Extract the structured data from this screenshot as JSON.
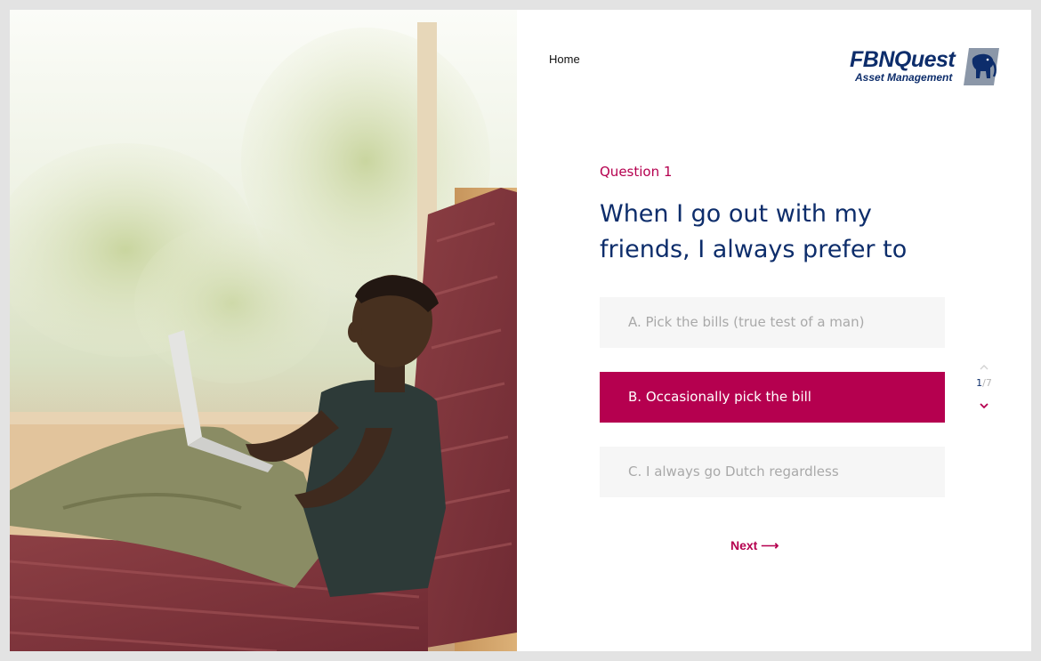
{
  "nav": {
    "home_label": "Home"
  },
  "brand": {
    "name": "FBNQuest",
    "tagline": "Asset Management",
    "logo_icon": "elephant-icon"
  },
  "question": {
    "label": "Question 1",
    "text": "When I go out with my friends, I always prefer to"
  },
  "options": [
    {
      "label": "A. Pick the bills (true test of a man)",
      "selected": false
    },
    {
      "label": "B. Occasionally pick the bill",
      "selected": true
    },
    {
      "label": "C. I always go Dutch regardless",
      "selected": false
    }
  ],
  "pager": {
    "current": "1",
    "separator": "/",
    "total": "7",
    "up_icon": "chevron-up-icon",
    "down_icon": "chevron-down-icon"
  },
  "next": {
    "label": "Next ⟶"
  },
  "colors": {
    "accent": "#b5004f",
    "navy": "#0d2d6b",
    "option_bg": "#f6f6f6",
    "option_text": "#a9a9a9"
  },
  "photo": {
    "subject": "man-with-laptop-photo"
  }
}
